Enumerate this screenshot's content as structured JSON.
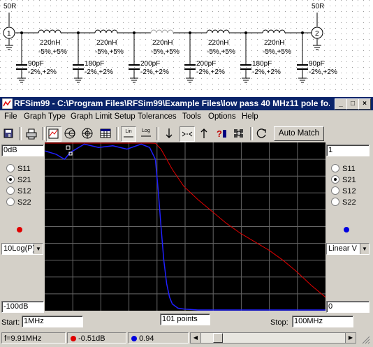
{
  "schematic": {
    "port1": "50R",
    "port2": "50R",
    "port1_symbol": "1",
    "port2_symbol": "2",
    "inductors": [
      {
        "value": "220nH",
        "tol": "-5%,+5%",
        "dim": false
      },
      {
        "value": "220nH",
        "tol": "-5%,+5%",
        "dim": false
      },
      {
        "value": "220nH",
        "tol": "-5%,+5%",
        "dim": true
      },
      {
        "value": "220nH",
        "tol": "-5%,+5%",
        "dim": false
      },
      {
        "value": "220nH",
        "tol": "-5%,+5%",
        "dim": false
      }
    ],
    "capacitors": [
      {
        "value": "90pF",
        "tol": "-2%,+2%"
      },
      {
        "value": "180pF",
        "tol": "-2%,+2%"
      },
      {
        "value": "200pF",
        "tol": "-2%,+2%"
      },
      {
        "value": "200pF",
        "tol": "-2%,+2%"
      },
      {
        "value": "180pF",
        "tol": "-2%,+2%"
      },
      {
        "value": "90pF",
        "tol": "-2%,+2%"
      }
    ]
  },
  "window": {
    "title": "RFSim99 - C:\\Program Files\\RFSim99\\Example Files\\low pass 40 MHz11 pole fo...",
    "controls": {
      "minimize": "_",
      "maximize": "□",
      "close": "×"
    }
  },
  "menu": [
    "File",
    "Graph Type",
    "Graph Limit Setup",
    "Tolerances",
    "Tools",
    "Options",
    "Help"
  ],
  "toolbar": {
    "icons": [
      "save-icon",
      "print-icon",
      "graph-icon",
      "smith-chart-icon",
      "polar-icon",
      "table-icon",
      "lin-icon",
      "log-icon",
      "arrow-down-icon",
      "arrows-in-icon",
      "arrow-up-icon",
      "query-icon",
      "settings-icon",
      "refresh-icon"
    ],
    "lin_label": "Lin",
    "log_label": "Log",
    "auto_match": "Auto Match"
  },
  "left_panel": {
    "top_value": "0dB",
    "bottom_value": "-100dB",
    "params": [
      "S11",
      "S21",
      "S12",
      "S22"
    ],
    "selected": "S21",
    "marker_color": "#e00000",
    "scale": "10Log(P)"
  },
  "right_panel": {
    "top_value": "1",
    "bottom_value": "0",
    "params": [
      "S11",
      "S21",
      "S12",
      "S22"
    ],
    "selected": "S21",
    "marker_color": "#0000e0",
    "scale": "Linear V"
  },
  "sweep": {
    "start_label": "Start:",
    "start_value": "1MHz",
    "points": "101 points",
    "stop_label": "Stop:",
    "stop_value": "100MHz"
  },
  "status": {
    "freq": "f=9.91MHz",
    "red_reading": "-0.51dB",
    "blue_reading": "0.94"
  },
  "chart_data": {
    "type": "line",
    "x_scale": "linear",
    "xlim": [
      1,
      100
    ],
    "grid": true,
    "series": [
      {
        "axis": "left",
        "ylim": [
          -100,
          0
        ],
        "color": "#e00000",
        "x": [
          1,
          10,
          20,
          30,
          38,
          40,
          42,
          44,
          46,
          48,
          50,
          55,
          60,
          65,
          70,
          75,
          80,
          85,
          90,
          95,
          100
        ],
        "y": [
          0,
          0,
          0,
          0,
          0,
          -0.5,
          -4,
          -10,
          -16,
          -21,
          -26,
          -34,
          -41,
          -48,
          -54,
          -59,
          -64,
          -70,
          -77,
          -85,
          -92
        ]
      },
      {
        "axis": "right",
        "ylim": [
          0,
          1
        ],
        "color": "#0000e0",
        "x": [
          1,
          5,
          8,
          10,
          15,
          20,
          25,
          30,
          35,
          38,
          40,
          41,
          42,
          43,
          44,
          45,
          46,
          48,
          50,
          55,
          60,
          100
        ],
        "y": [
          0.95,
          0.93,
          0.9,
          0.94,
          0.99,
          0.97,
          0.98,
          0.96,
          0.99,
          0.97,
          0.9,
          0.72,
          0.5,
          0.3,
          0.16,
          0.08,
          0.04,
          0.015,
          0.01,
          0.004,
          0.002,
          0.001
        ]
      }
    ]
  }
}
